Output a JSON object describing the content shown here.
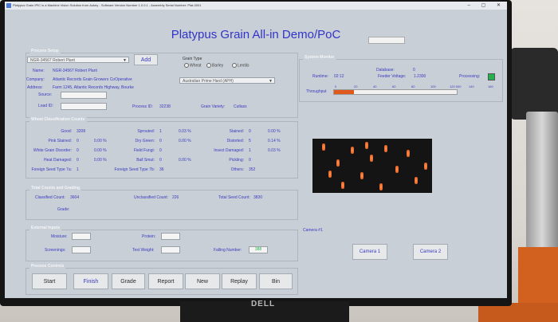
{
  "window": {
    "title": "Platypus Grain IPIC is a Machine Vision Solution from Aukey - Software Version Number 1.0.0.1 - Assembly Serial Number: Plat-0001",
    "controls": "– ▢ ✕"
  },
  "app_title": "Platypus Grain All-in     Demo/PoC",
  "process_setup": {
    "title": "Process Setup",
    "grower_combo": "NGR-34567 Robert Plant",
    "add_label": "Add",
    "name_label": "Name:",
    "name_value": "NGR-34567 Robert Plant",
    "company_label": "Company:",
    "company_value": "Atlantic Records Grain Growers CoOperative",
    "address_label": "Address:",
    "address_value": "Farm 1245, Atlantic Records Highway, Bourke",
    "grain_type_label": "Grain Type",
    "grain_types": [
      "Wheat",
      "Barley",
      "Lentils"
    ],
    "grade_combo": "Australian Prime Hard (APH)",
    "source_label": "Source:",
    "load_id_label": "Load ID:",
    "process_id_label": "Process ID:",
    "process_id_value": "32238",
    "grain_variety_label": "Grain Variety:",
    "grain_variety_value": "Cutlass"
  },
  "system_monitor": {
    "title": "System Monitor",
    "database_label": "Database:",
    "database_value": "0",
    "runtime_label": "Runtime:",
    "runtime_value": "02:12",
    "feeder_label": "Feeder Voltage:",
    "feeder_value": "1.2300",
    "processing_label": "Processing:",
    "scale_ticks": [
      "0",
      "20",
      "40",
      "60",
      "80",
      "100",
      "120 000",
      "140",
      "160"
    ],
    "throughput_label": "Throughput",
    "throughput_fraction": 0.16,
    "led_color": "#22b14c"
  },
  "wheat_counts": {
    "title": "Wheat Classification Counts",
    "rows": [
      [
        {
          "l": "Good:",
          "v": "3208"
        },
        {
          "l": "Sprouted:",
          "v": "1",
          "p": "0.03 %"
        },
        {
          "l": "Stained:",
          "v": "0",
          "p": "0.00 %"
        }
      ],
      [
        {
          "l": "Pink Stained:",
          "v": "0",
          "p": "0.00 %"
        },
        {
          "l": "Dry Green:",
          "v": "0",
          "p": "0.00 %"
        },
        {
          "l": "Distorted:",
          "v": "5",
          "p": "0.14 %"
        }
      ],
      [
        {
          "l": "White Grain Disorder:",
          "v": "0",
          "p": "0.00 %"
        },
        {
          "l": "Field Fungi:",
          "v": "0"
        },
        {
          "l": "Insect Damaged:",
          "v": "1",
          "p": "0.03 %"
        }
      ],
      [
        {
          "l": "Heat Damaged:",
          "v": "0",
          "p": "0.00 %"
        },
        {
          "l": "Ball Smut:",
          "v": "0",
          "p": "0.00 %"
        },
        {
          "l": "Pickling:",
          "v": "0"
        }
      ],
      [
        {
          "l": "Foreign Seed Type 7a:",
          "v": "1"
        },
        {
          "l": "Foreign Seed Type 7b:",
          "v": "36"
        },
        {
          "l": "Others:",
          "v": "352"
        }
      ]
    ]
  },
  "totals": {
    "title": "Total Counts and Grading",
    "classified_label": "Classified Count:",
    "classified_value": "3604",
    "unclassified_label": "Unclassified Count:",
    "unclassified_value": "226",
    "total_label": "Total Seed Count:",
    "total_value": "3830",
    "grade_label": "Grade:"
  },
  "external_inputs": {
    "title": "External Inputs",
    "moisture_label": "Moisture:",
    "protein_label": "Protein:",
    "screenings_label": "Screenings:",
    "test_weight_label": "Test Weight:",
    "falling_number_label": "Falling Number:",
    "falling_number_value": "388"
  },
  "camera": {
    "label": "Camera #1",
    "camera1_button": "Camera 1",
    "camera2_button": "Camera 2"
  },
  "process_controls": {
    "title": "Process Controls",
    "buttons": [
      "Start",
      "Finish",
      "Grade",
      "Report",
      "New",
      "Replay",
      "Bin"
    ]
  },
  "brand_logo": "DELL"
}
